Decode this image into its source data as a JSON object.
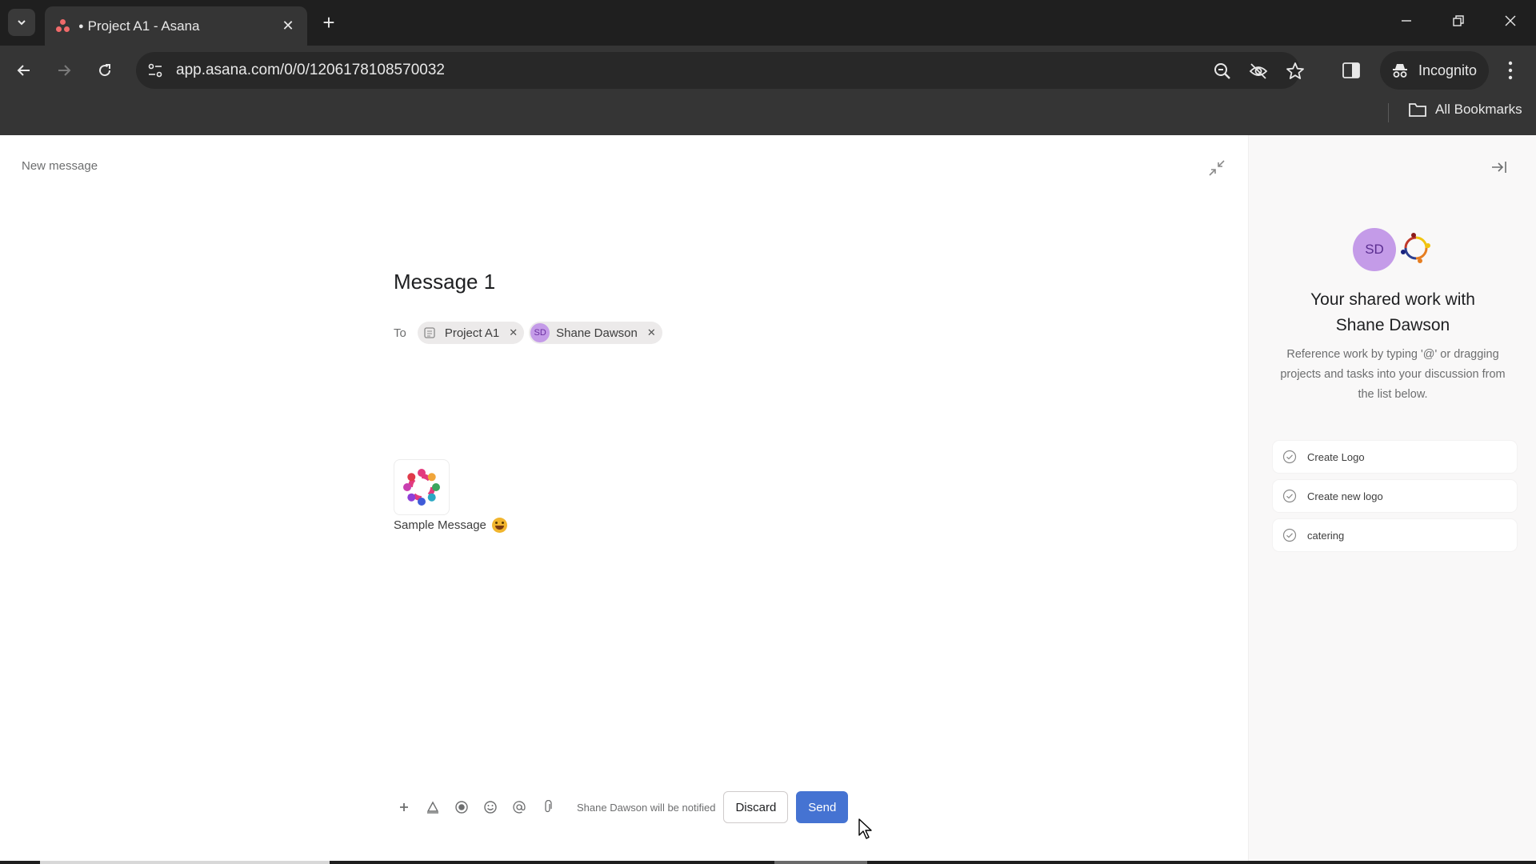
{
  "browser": {
    "tab_title": "Project A1 - Asana",
    "tab_dot": "●",
    "url": "app.asana.com/0/0/1206178108570032",
    "incognito_label": "Incognito",
    "bookmarks_label": "All Bookmarks",
    "icons": {
      "tab_search": "chevron-down-icon",
      "new_tab": "plus-icon",
      "back": "arrow-left-icon",
      "forward": "arrow-right-icon",
      "reload": "reload-icon",
      "site_info": "tune-icon",
      "zoom": "zoom-out-icon",
      "tracking": "eye-off-icon",
      "bookmark": "star-icon",
      "side_panel": "side-panel-icon",
      "menu": "more-vertical-icon"
    }
  },
  "composer": {
    "header_label": "New message",
    "title": "Message 1",
    "to_label": "To",
    "recipients": [
      {
        "type": "project",
        "label": "Project A1"
      },
      {
        "type": "user",
        "initials": "SD",
        "label": "Shane Dawson"
      }
    ],
    "body": "Sample Message",
    "body_emoji": "grinning-face",
    "notify_text": "Shane Dawson will be notified",
    "discard_label": "Discard",
    "send_label": "Send",
    "toolbar_icons": [
      "plus-icon",
      "text-format-icon",
      "record-icon",
      "emoji-icon",
      "mention-icon",
      "attach-icon"
    ]
  },
  "side_panel": {
    "avatar_initials": "SD",
    "title": "Your shared work with Shane Dawson",
    "description": "Reference work by typing '@' or dragging projects and tasks into your discussion from the list below.",
    "tasks": [
      {
        "label": "Create Logo"
      },
      {
        "label": "Create new logo"
      },
      {
        "label": "catering"
      }
    ]
  },
  "colors": {
    "send": "#4573d2",
    "avatar": "#c49be8",
    "chrome_dark": "#1f1f1f",
    "chrome": "#353535"
  }
}
